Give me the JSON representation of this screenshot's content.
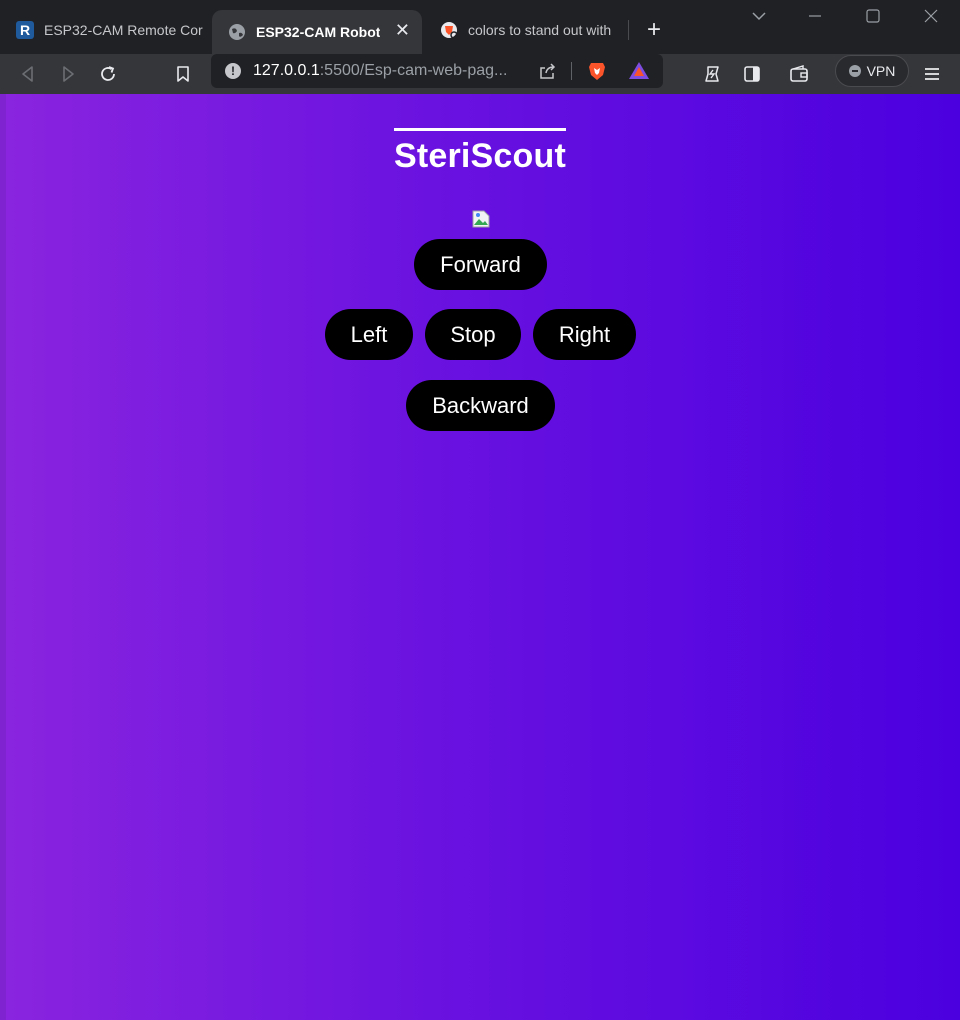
{
  "browser": {
    "tabs": [
      {
        "label": "ESP32-CAM Remote Cor",
        "icon": "r-logo-icon"
      },
      {
        "label": "ESP32-CAM Robot",
        "icon": "globe-icon",
        "active": true,
        "close": "✕"
      },
      {
        "label": "colors to stand out with",
        "icon": "brave-search-icon"
      }
    ],
    "new_tab": "+",
    "url": {
      "host": "127.0.0.1",
      "path": ":5500/Esp-cam-web-pag..."
    },
    "vpn_label": "VPN"
  },
  "page": {
    "title": "SteriScout",
    "controls": {
      "forward": "Forward",
      "left": "Left",
      "stop": "Stop",
      "right": "Right",
      "backward": "Backward"
    },
    "colors": {
      "gradient_start": "#8a24df",
      "gradient_end": "#4b00df",
      "button_bg": "#000000",
      "button_text": "#ffffff"
    }
  }
}
